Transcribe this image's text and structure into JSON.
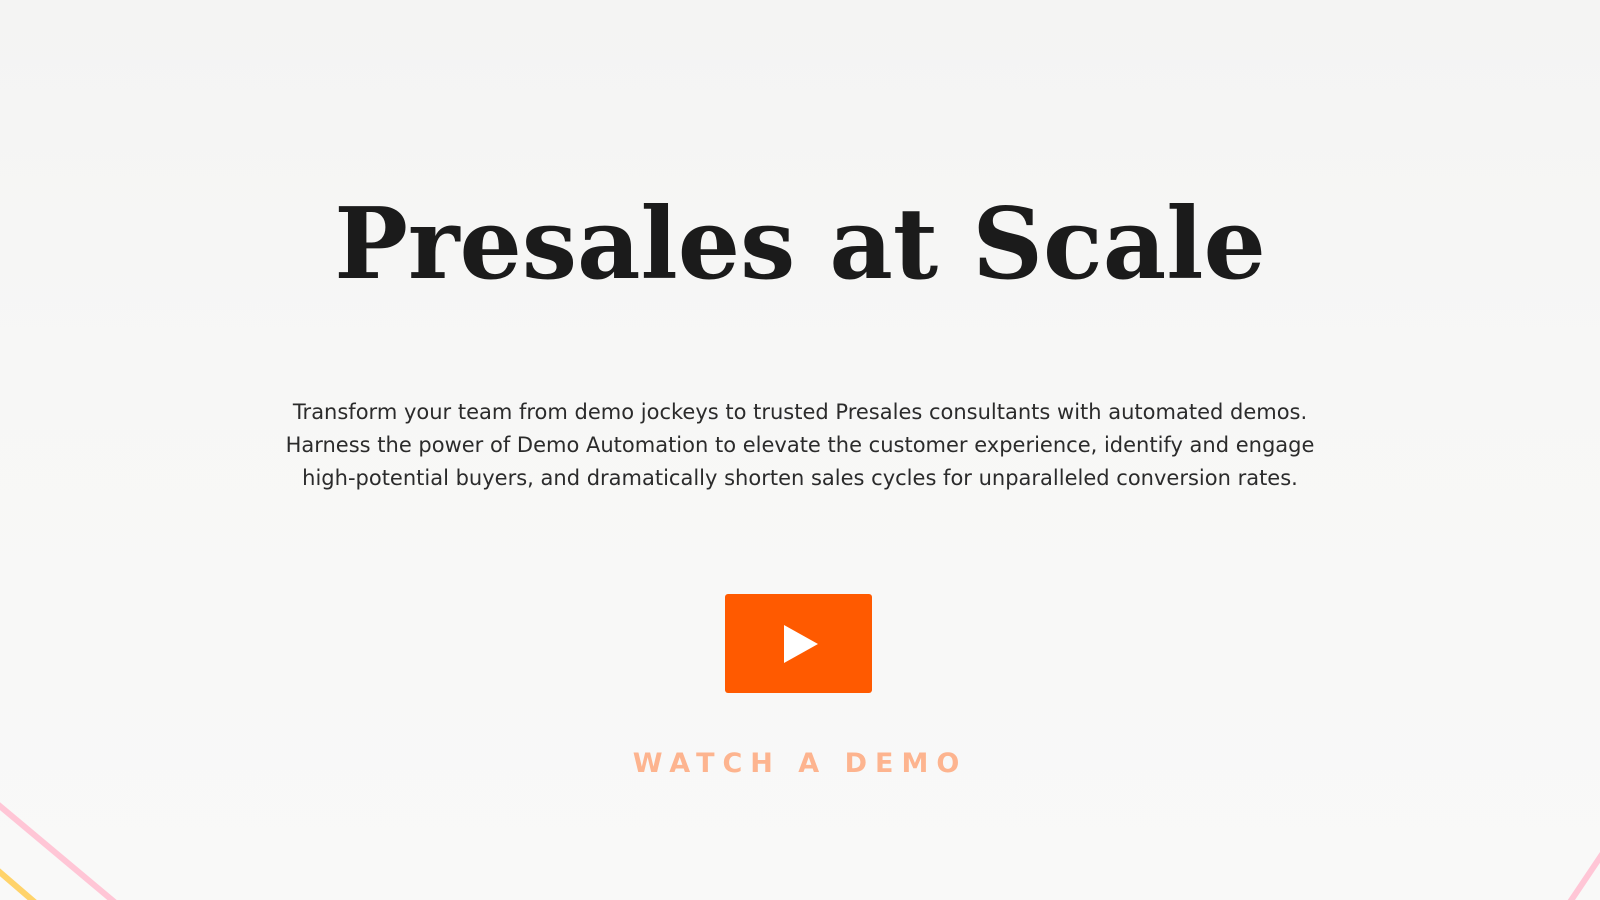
{
  "hero": {
    "title": "Presales at Scale",
    "subtitle_lines": [
      "Transform your team from demo jockeys to trusted Presales consultants with automated demos.",
      "Harness the power of Demo Automation to elevate the customer experience, identify and engage",
      "high-potential buyers, and dramatically shorten sales cycles for unparalleled conversion rates."
    ],
    "watch_label": "WATCH A DEMO",
    "play_icon": "play-icon"
  },
  "colors": {
    "background": "#f7f7f6",
    "title": "#1b1b1b",
    "body_text": "#2b2b2b",
    "accent": "#ff5a00",
    "accent_light": "#fdb48f",
    "deco_pink": "#ffc6d6",
    "deco_yellow": "#ffd36a"
  }
}
